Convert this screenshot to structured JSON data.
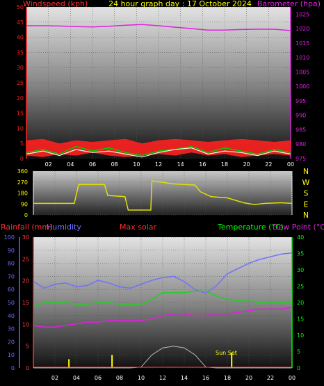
{
  "header": {
    "left": "Windspeed (kph)",
    "center": "24 hour graph day : 17 October 2024",
    "right": "Barometer (hpa)"
  },
  "x_ticks": [
    "02",
    "04",
    "06",
    "08",
    "10",
    "12",
    "14",
    "16",
    "18",
    "20",
    "22",
    "00"
  ],
  "colors": {
    "wind": "#ff2020",
    "gust": "#00cc00",
    "barometer": "#e020e0",
    "direction": "#e0e000",
    "humidity": "#7070ff",
    "temperature": "#20d020",
    "dewpoint": "#e020e0",
    "rain": "#ff4040",
    "solar": "#bbbbbb",
    "accent_yellow": "#ffff00",
    "accent_green": "#00ff00"
  },
  "chart_data": [
    {
      "type": "line",
      "title": "24 hour graph day : 17 October 2024",
      "ylabel": "Windspeed (kph)",
      "y2label": "Barometer (hpa)",
      "ylim": [
        0,
        50
      ],
      "y_ticks": [
        "0",
        "5",
        "10",
        "15",
        "20",
        "25",
        "30",
        "35",
        "40",
        "45",
        "50"
      ],
      "y2lim": [
        975,
        1027.5
      ],
      "y2_ticks": [
        "975",
        "980",
        "985",
        "990",
        "995",
        "1000",
        "1005",
        "1010",
        "1015",
        "1020",
        "1025"
      ],
      "x_hours": [
        0.0,
        1.5,
        3.0,
        4.5,
        6.0,
        7.5,
        9.0,
        10.5,
        12.0,
        13.5,
        15.0,
        16.5,
        18.0,
        19.5,
        21.0,
        22.5,
        24.0
      ],
      "series": [
        {
          "role": "wind_max",
          "values": [
            6,
            6.5,
            5,
            6,
            5.5,
            6,
            6.5,
            5,
            6,
            6.5,
            6,
            5.5,
            6,
            6.5,
            6,
            5.5,
            6
          ]
        },
        {
          "role": "wind_min",
          "values": [
            1,
            0.5,
            1.5,
            1,
            2,
            1,
            0.5,
            1,
            1.5,
            1,
            2,
            1,
            1.5,
            0.5,
            1,
            1.5,
            1
          ]
        },
        {
          "role": "gust",
          "values": [
            2,
            3,
            1.5,
            4,
            2.5,
            3.5,
            2,
            1,
            2.5,
            3,
            4,
            2,
            3.5,
            2.5,
            1.5,
            3,
            2
          ]
        },
        {
          "role": "speed",
          "values": [
            1.5,
            2.5,
            1,
            3,
            2,
            2.5,
            1.5,
            0.5,
            2,
            3,
            3.5,
            1.5,
            2.5,
            2,
            1,
            2.5,
            1.5
          ]
        },
        {
          "role": "barometer",
          "values": [
            1021,
            1021,
            1020.9,
            1020.7,
            1020.6,
            1020.8,
            1021.2,
            1021.4,
            1021,
            1020.5,
            1020,
            1019.5,
            1019.5,
            1019.7,
            1019.8,
            1019.8,
            1019.3
          ]
        }
      ]
    },
    {
      "type": "line",
      "ylim": [
        0,
        360
      ],
      "y_ticks": [
        "0",
        "90",
        "180",
        "270",
        "360"
      ],
      "compass": [
        "N",
        "W",
        "S",
        "E",
        "N"
      ],
      "x_hours": [
        0,
        3.8,
        4.2,
        6.6,
        6.9,
        8.5,
        8.8,
        10.9,
        11.0,
        13,
        15,
        15.5,
        16.5,
        18,
        19.5,
        20.5,
        21.5,
        23,
        24
      ],
      "values": [
        95,
        95,
        250,
        250,
        160,
        150,
        40,
        40,
        280,
        255,
        245,
        190,
        150,
        140,
        100,
        85,
        95,
        100,
        95
      ]
    },
    {
      "type": "line",
      "header": {
        "rain_label": "Rainfall (mm)",
        "humidity_label": "Humidity",
        "solar_label": "Max solar",
        "temp_label": "Temperature (°C)",
        "dew_label": "Dew Point (°C)"
      },
      "ylim": [
        0,
        100
      ],
      "y_ticks": [
        "0",
        "10",
        "20",
        "30",
        "40",
        "50",
        "60",
        "70",
        "80",
        "90",
        "100"
      ],
      "rain_ticks": [
        "0",
        "5",
        "10",
        "15",
        "20",
        "25",
        "30"
      ],
      "y2lim": [
        0,
        40
      ],
      "y2_ticks": [
        "0",
        "5",
        "10",
        "15",
        "20",
        "25",
        "30",
        "35",
        "40"
      ],
      "annotation": "Sun Set",
      "x_hours": [
        0,
        1,
        2,
        3,
        4,
        5,
        6,
        7,
        8,
        9,
        10,
        11,
        12,
        13,
        14,
        15,
        16,
        17,
        18,
        19,
        20,
        21,
        22,
        23,
        24
      ],
      "series": [
        {
          "role": "humidity",
          "values": [
            66,
            61,
            64,
            65,
            62,
            63,
            67,
            65,
            62,
            61,
            64,
            67,
            69,
            70,
            66,
            60,
            57,
            63,
            72,
            76,
            80,
            83,
            85,
            87,
            88
          ]
        },
        {
          "role": "temperature",
          "values": [
            19,
            20,
            20,
            20,
            19.5,
            19.5,
            20,
            20,
            19.5,
            19.5,
            19.5,
            21,
            23,
            23,
            23,
            23.5,
            23.5,
            22,
            21,
            20.5,
            20.5,
            20,
            20,
            20,
            20
          ]
        },
        {
          "role": "dewpoint",
          "values": [
            13,
            12.5,
            12.5,
            13,
            13.5,
            14,
            14,
            14.5,
            14.5,
            14.5,
            14.5,
            15,
            16,
            16.5,
            16.5,
            16,
            16,
            16.5,
            16.5,
            17,
            17.5,
            18,
            18,
            18,
            18.5
          ]
        },
        {
          "role": "max_solar",
          "values": [
            0,
            0,
            0,
            0,
            0,
            0,
            0,
            0,
            0,
            0,
            0.2,
            3,
            4.6,
            5,
            4.6,
            3,
            0.2,
            0,
            0,
            0,
            0,
            0,
            0,
            0,
            0
          ]
        }
      ],
      "rain_bars": [
        {
          "hour": 3.3,
          "mm": 2
        },
        {
          "hour": 7.3,
          "mm": 3
        },
        {
          "hour": 18.4,
          "mm": 3.5
        }
      ]
    }
  ]
}
